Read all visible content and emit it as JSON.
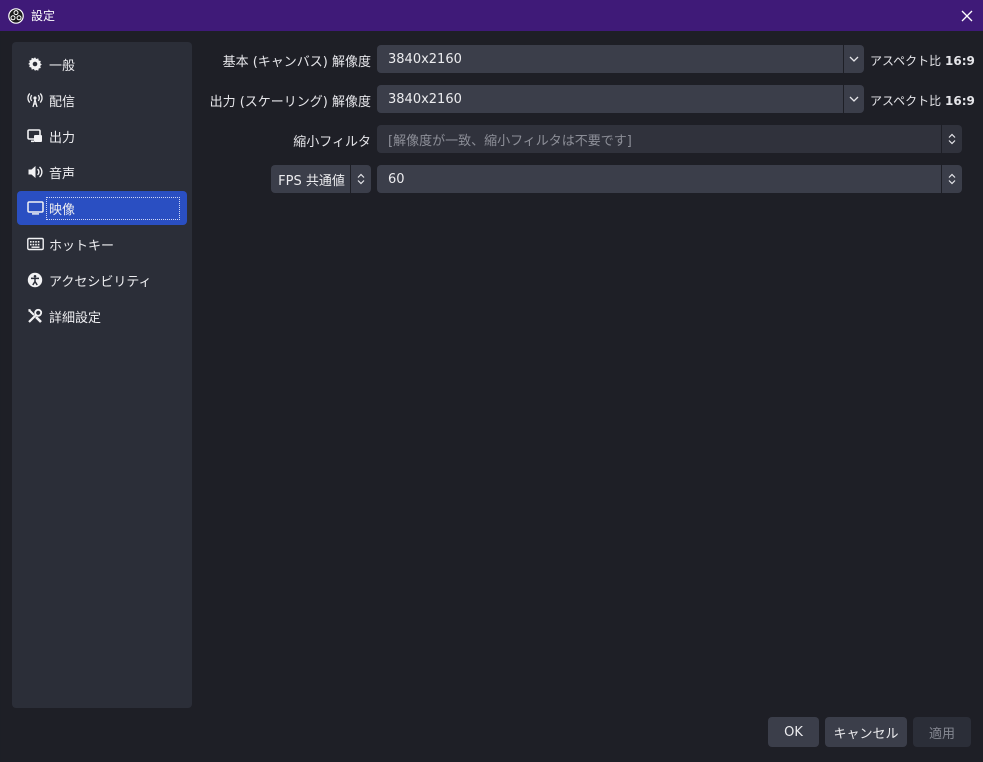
{
  "window": {
    "title": "設定",
    "title_icon": "obs-logo-icon",
    "accent_color": "#3f1a78"
  },
  "sidebar": {
    "items": [
      {
        "label": "一般",
        "icon": "gear-icon"
      },
      {
        "label": "配信",
        "icon": "antenna-icon"
      },
      {
        "label": "出力",
        "icon": "output-icon"
      },
      {
        "label": "音声",
        "icon": "speaker-icon"
      },
      {
        "label": "映像",
        "icon": "monitor-icon",
        "selected": true
      },
      {
        "label": "ホットキー",
        "icon": "keyboard-icon"
      },
      {
        "label": "アクセシビリティ",
        "icon": "accessibility-icon"
      },
      {
        "label": "詳細設定",
        "icon": "tools-icon"
      }
    ],
    "selected_color": "#2a4fc2"
  },
  "video": {
    "base_resolution": {
      "label": "基本 (キャンバス) 解像度",
      "value": "3840x2160",
      "aspect_prefix": "アスペクト比",
      "aspect_value": "16:9"
    },
    "output_resolution": {
      "label": "出力 (スケーリング) 解像度",
      "value": "3840x2160",
      "aspect_prefix": "アスペクト比",
      "aspect_value": "16:9"
    },
    "downscale_filter": {
      "label": "縮小フィルタ",
      "value": "[解像度が一致、縮小フィルタは不要です]"
    },
    "fps": {
      "mode": "FPS 共通値",
      "value": "60"
    }
  },
  "footer": {
    "ok_label": "OK",
    "cancel_label": "キャンセル",
    "apply_label": "適用"
  }
}
